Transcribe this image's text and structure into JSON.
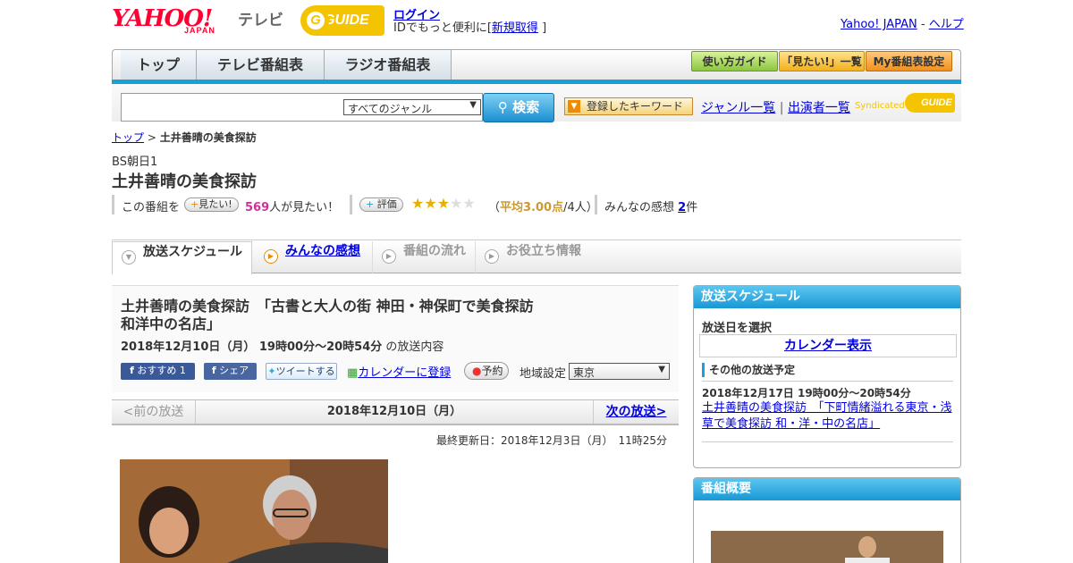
{
  "header": {
    "yahoo_logo": "YAHOO!",
    "yahoo_japan": "JAPAN",
    "tv_label": "テレビ",
    "gguide_logo": "GUIDE",
    "login_link": "ログイン",
    "id_text_prefix": "IDでもっと便利に[",
    "signup_link": "新規取得",
    "id_text_suffix": "]",
    "yahoo_japan_link": "Yahoo! JAPAN",
    "separator": "-",
    "help_link": "ヘルプ"
  },
  "nav": {
    "tabs": [
      "トップ",
      "テレビ番組表",
      "ラジオ番組表"
    ],
    "buttons": [
      "使い方ガイド",
      "「見たい!」一覧",
      "My番組表設定"
    ]
  },
  "search": {
    "genre_select": "すべてのジャンル",
    "search_button": "検索",
    "keyword_button": "登録したキーワード",
    "genre_list_link": "ジャンル一覧",
    "cast_list_link": "出演者一覧",
    "syndicated": "Syndicated"
  },
  "breadcrumb": {
    "top_link": "トップ",
    "sep": ">",
    "current": "土井善晴の美食探訪"
  },
  "program": {
    "channel": "BS朝日1",
    "title": "土井善晴の美食探訪",
    "want_prefix": "この番組を",
    "want_button": "見たい!",
    "want_count": "569",
    "want_suffix": "人が見たい！",
    "rate_button": "評価",
    "rating_value": 3,
    "rating_max": 5,
    "rating_text_open": "（",
    "rating_avg": "平均3.00点",
    "rating_people": "/4人）",
    "comments_label": "みんなの感想",
    "comments_count": "2",
    "comments_suffix": "件"
  },
  "content_tabs": [
    "放送スケジュール",
    "みんなの感想",
    "番組の流れ",
    "お役立ち情報"
  ],
  "episode": {
    "title": "土井善晴の美食探訪　「古書と大人の街 神田・神保町で美食探訪　和洋中の名店」",
    "date": "2018年12月10日（月） 19時00分～20時54分",
    "date_suffix": "の放送内容",
    "fb_recommend": "おすすめ 1",
    "fb_share": "シェア",
    "tweet": "ツイートする",
    "calendar_link": "カレンダーに登録",
    "reserve_button": "予約",
    "region_label": "地域設定",
    "region_value": "東京"
  },
  "pager": {
    "prev": "<前の放送",
    "current": "2018年12月10日（月）",
    "next": "次の放送>"
  },
  "last_updated": "最終更新日：2018年12月3日（月）　11時25分",
  "sidebar": {
    "schedule_header": "放送スケジュール",
    "select_date": "放送日を選択",
    "calendar_link": "カレンダー表示",
    "other_header": "その他の放送予定",
    "other_date": "2018年12月17日  19時00分～20時54分",
    "other_link": "土井善晴の美食探訪　「下町情緒溢れる東京・浅草で美食探訪 和・洋・中の名店」",
    "overview_header": "番組概要"
  },
  "colors": {
    "accent_blue": "#1aa0d8",
    "yahoo_red": "#ff0033",
    "gguide_yellow": "#f5c400",
    "rating_red": "#cc3333"
  }
}
